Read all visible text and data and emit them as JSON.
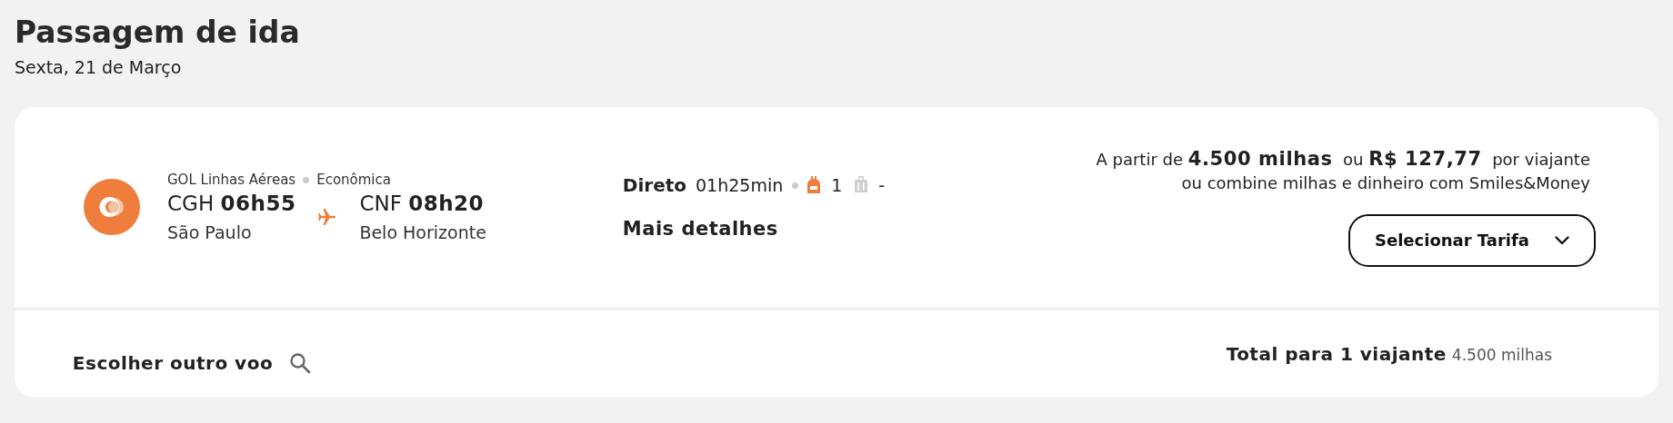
{
  "header": {
    "title": "Passagem de ida",
    "date": "Sexta, 21 de Março"
  },
  "flight": {
    "airline": "GOL Linhas Aéreas",
    "cabin": "Econômica",
    "departure": {
      "code": "CGH",
      "time": "06h55",
      "city": "São Paulo"
    },
    "arrival": {
      "code": "CNF",
      "time": "08h20",
      "city": "Belo Horizonte"
    },
    "stops": "Direto",
    "duration": "01h25min",
    "baggage": [
      {
        "kind": "backpack",
        "included": true,
        "count": "1"
      },
      {
        "kind": "suitcase",
        "included": false,
        "count": "-"
      }
    ],
    "details_link": "Mais detalhes",
    "price_line": "A partir de **4.500 milhas**  ou **R$ 127,77**  por viajante",
    "combine_line": "ou combine milhas e dinheiro com Smiles&Money",
    "select_button": "Selecionar Tarifa"
  },
  "footer": {
    "other_flight": "Escolher outro voo",
    "total_label": "Total para 1 viajante",
    "total_value": "4.500 milhas"
  }
}
